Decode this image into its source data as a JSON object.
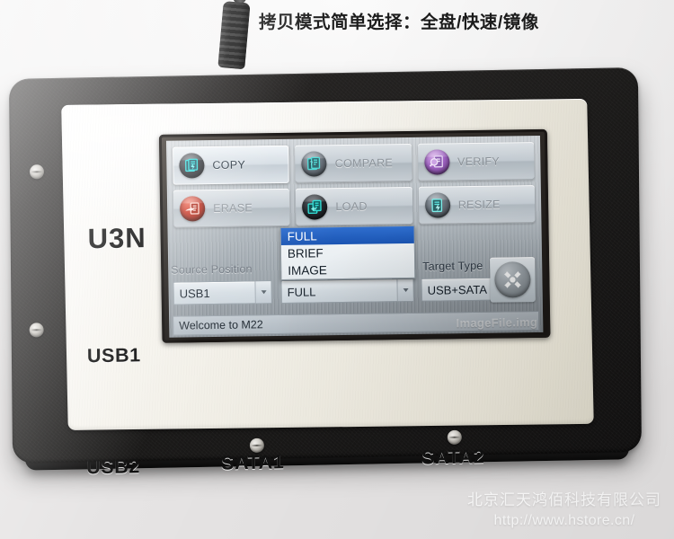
{
  "caption": "拷贝模式简单选择：全盘/快速/镜像",
  "device": {
    "model_label": "U3N",
    "port_labels": {
      "usb1": "USB1",
      "usb2": "USB2",
      "sata1": "SATA1",
      "sata2": "SATA2"
    }
  },
  "screen": {
    "buttons": [
      {
        "label": "COPY",
        "icon": "copy-document-icon",
        "icon_color": "#18d7d7",
        "bubble": "dark",
        "state": "selected"
      },
      {
        "label": "COMPARE",
        "icon": "compare-document-icon",
        "icon_color": "#2fd0cf",
        "bubble": "steel",
        "state": "normal"
      },
      {
        "label": "VERIFY",
        "icon": "verify-magnifier-icon",
        "icon_color": "#e6d4f2",
        "bubble": "purple",
        "state": "normal"
      },
      {
        "label": "ERASE",
        "icon": "erase-hand-icon",
        "icon_color": "#ffd9d2",
        "bubble": "red",
        "state": "normal"
      },
      {
        "label": "LOAD",
        "icon": "load-document-icon",
        "icon_color": "#2fe0d8",
        "bubble": "dark",
        "state": "normal"
      },
      {
        "label": "RESIZE",
        "icon": "resize-document-icon",
        "icon_color": "#4fe3e0",
        "bubble": "steel",
        "state": "normal"
      }
    ],
    "source_position": {
      "label": "Source Position",
      "value": "USB1"
    },
    "copy_mode": {
      "value": "FULL",
      "options": [
        "FULL",
        "BRIEF",
        "IMAGE"
      ],
      "selected_option": "FULL",
      "expanded": true
    },
    "target_type": {
      "label": "Target Type",
      "value": "USB+SATA"
    },
    "settings_button_icon": "wrench-icon",
    "status_text": "Welcome to M22",
    "image_file_watermark": "ImageFile.img"
  },
  "watermark": {
    "company": "北京汇天鸿佰科技有限公司",
    "url": "http://www.hstore.cn/"
  }
}
